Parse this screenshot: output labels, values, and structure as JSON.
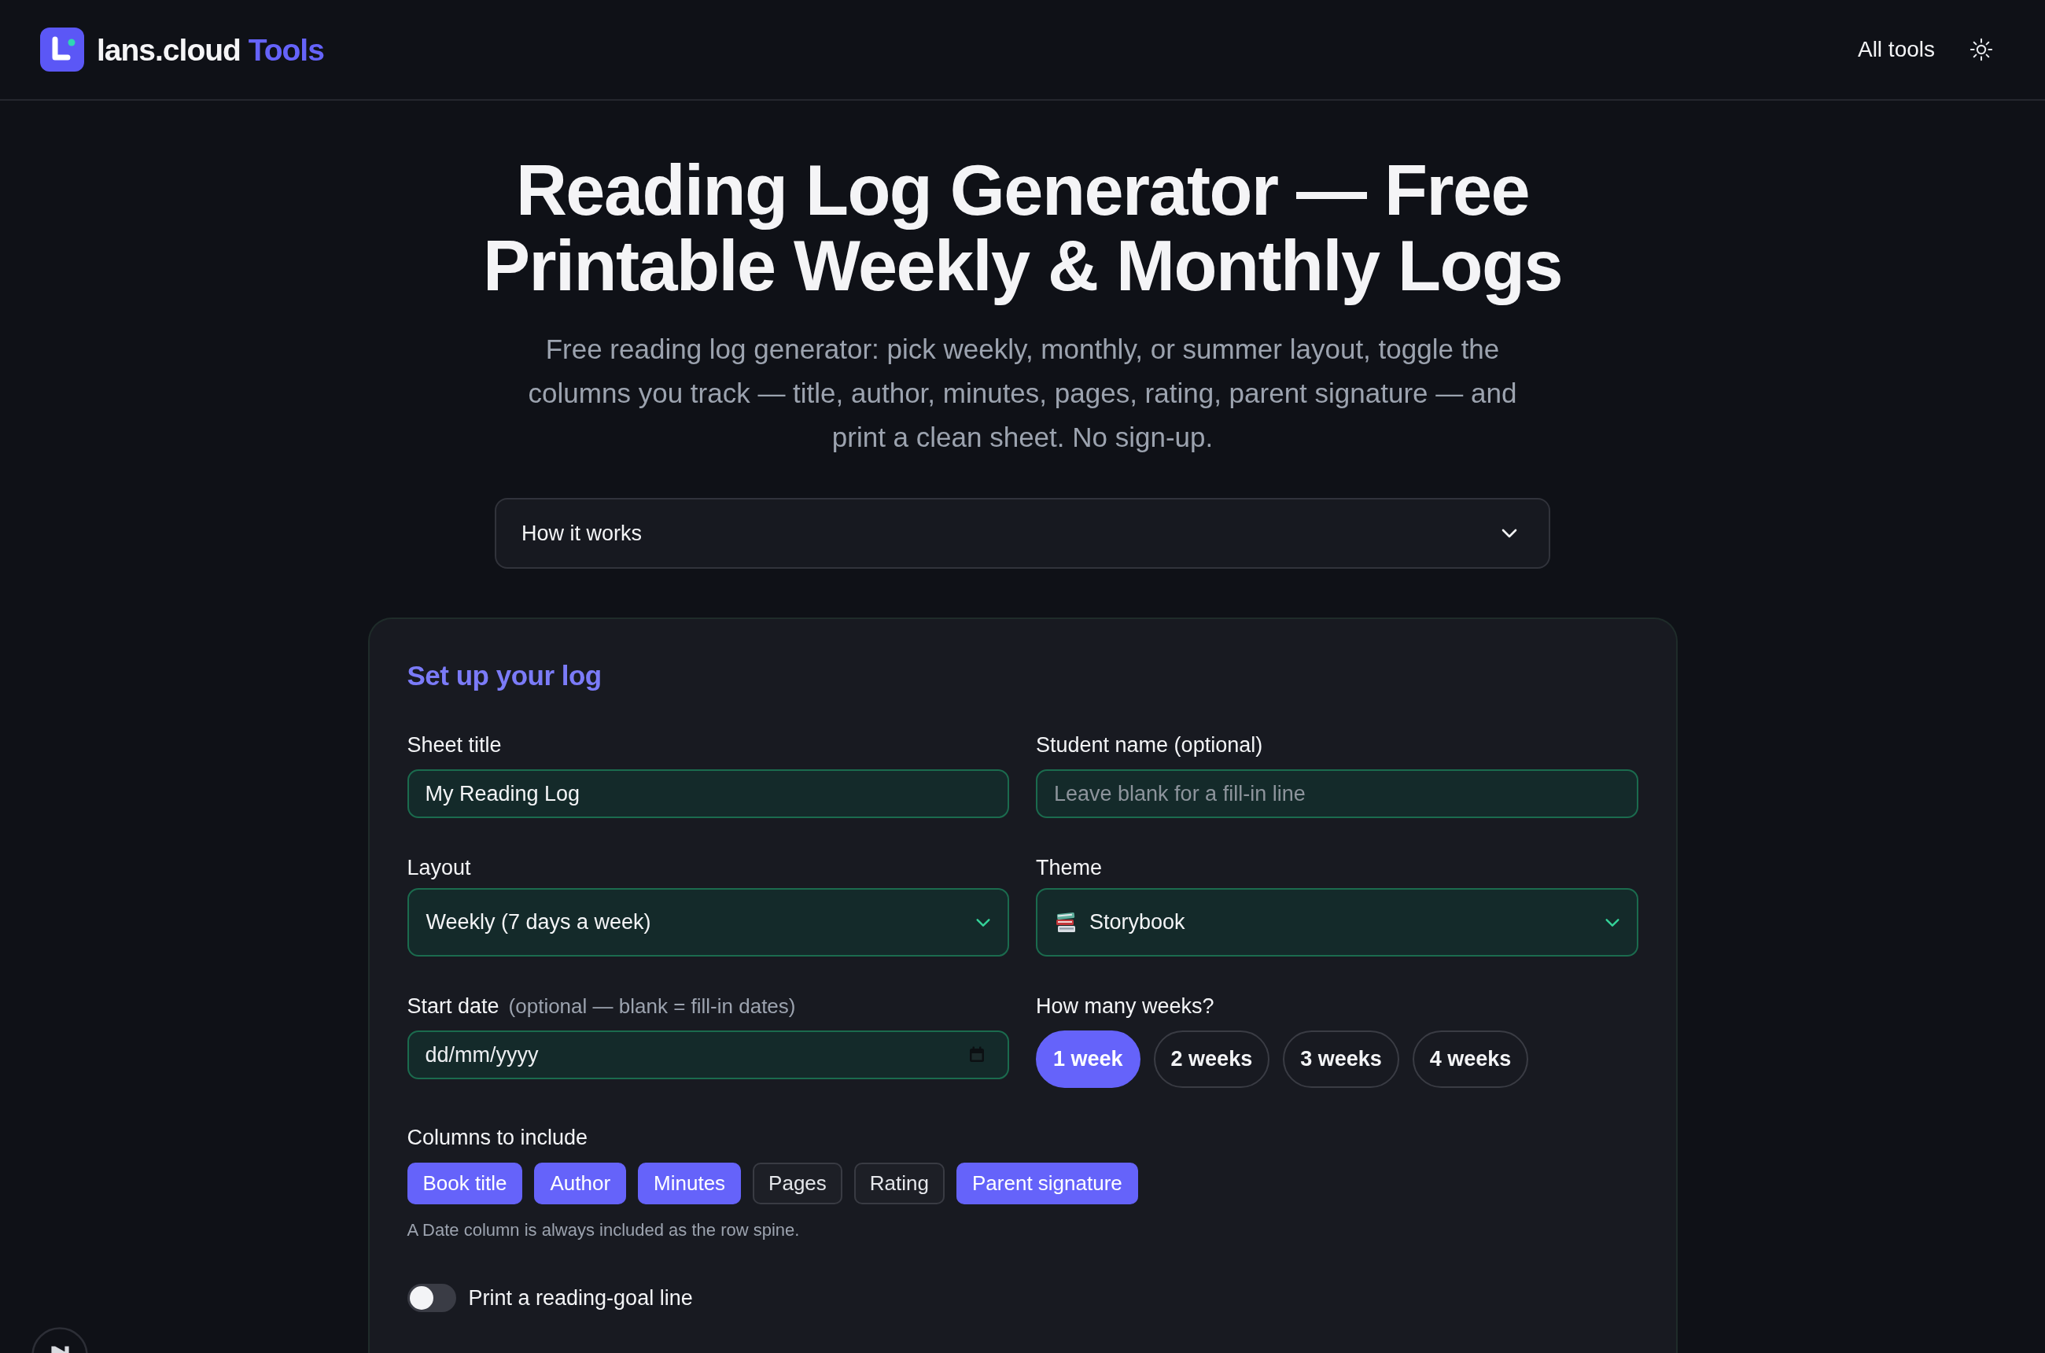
{
  "header": {
    "brand": {
      "name": "lans.cloud",
      "accent": "Tools"
    },
    "nav": [
      {
        "label": "All tools"
      }
    ]
  },
  "hero": {
    "title": "Reading Log Generator — Free Printable Weekly & Monthly Logs",
    "subtitle": "Free reading log generator: pick weekly, monthly, or summer layout, toggle the columns you track — title, author, minutes, pages, rating, parent signature — and print a clean sheet. No sign-up."
  },
  "accordion": {
    "label": "How it works",
    "expanded": false
  },
  "form": {
    "title": "Set up your log",
    "fields": [
      {
        "kind": "text",
        "label": "Sheet title",
        "value": "My Reading Log"
      },
      {
        "kind": "text",
        "label": "Student name (optional)",
        "placeholder": "Leave blank for a fill-in line"
      },
      {
        "kind": "select",
        "label": "Layout",
        "value": "Weekly (7 days a week)"
      },
      {
        "kind": "icon_select",
        "label": "Theme",
        "value": "Storybook"
      },
      {
        "kind": "date",
        "label": "Start date",
        "hint": "(optional — blank = fill-in dates)",
        "placeholder": "dd/mm/yyyy"
      },
      {
        "kind": "pills",
        "label": "How many weeks?",
        "options": [
          {
            "label": "1 week",
            "selected": true
          },
          {
            "label": "2 weeks",
            "selected": false
          },
          {
            "label": "3 weeks",
            "selected": false
          },
          {
            "label": "4 weeks",
            "selected": false
          }
        ]
      }
    ],
    "columns": {
      "label": "Columns to include",
      "options": [
        {
          "label": "Book title",
          "selected": true
        },
        {
          "label": "Author",
          "selected": true
        },
        {
          "label": "Minutes",
          "selected": true
        },
        {
          "label": "Pages",
          "selected": false
        },
        {
          "label": "Rating",
          "selected": false
        },
        {
          "label": "Parent signature",
          "selected": true
        }
      ],
      "note": "A Date column is always included as the row spine."
    },
    "goal_toggle": {
      "label": "Print a reading-goal line",
      "on": false
    }
  }
}
